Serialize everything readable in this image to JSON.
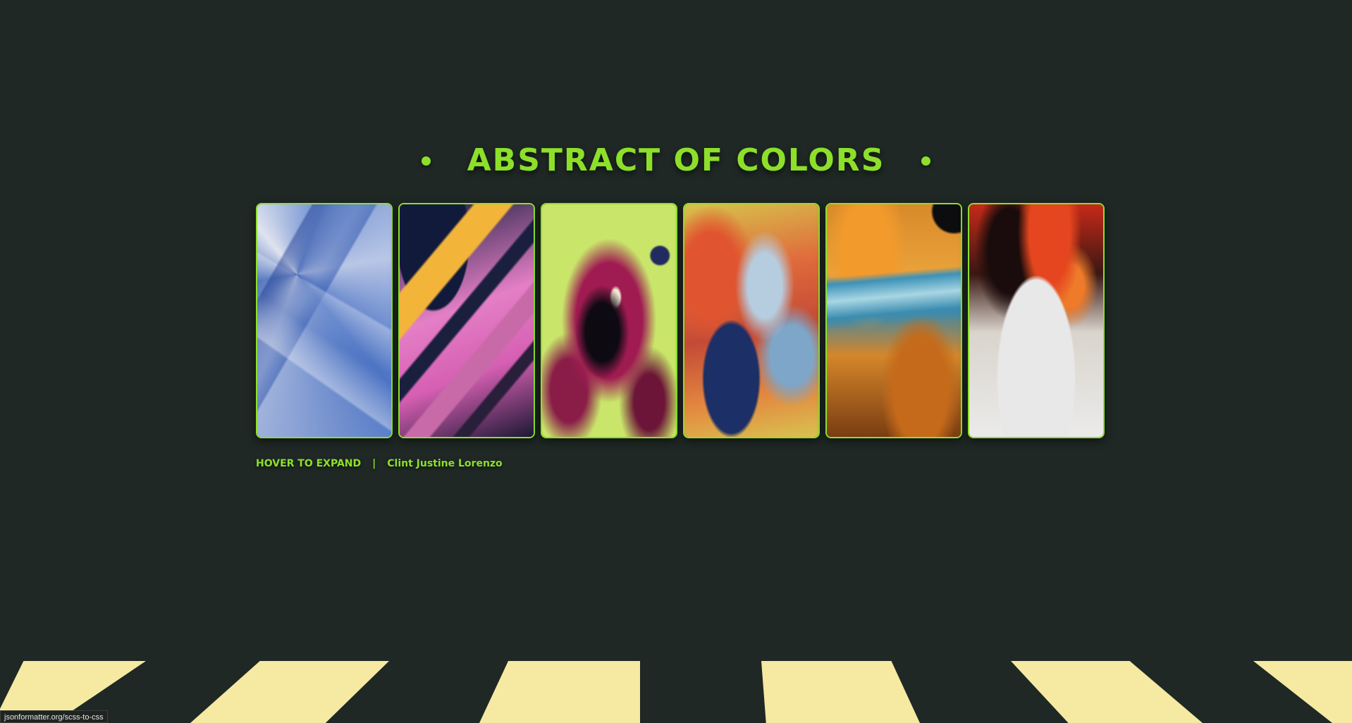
{
  "header": {
    "title": "ABSTRACT OF COLORS"
  },
  "gallery": {
    "cards": [
      {
        "name": "card-1"
      },
      {
        "name": "card-2"
      },
      {
        "name": "card-3"
      },
      {
        "name": "card-4"
      },
      {
        "name": "card-5"
      },
      {
        "name": "card-6"
      }
    ]
  },
  "footer": {
    "hint": "HOVER TO EXPAND",
    "separator": "|",
    "author": "Clint Justine Lorenzo"
  },
  "status_bar": {
    "url": "jsonformatter.org/scss-to-css"
  },
  "colors": {
    "background": "#1f2825",
    "accent": "#8de02a",
    "stripe": "#f6e9a2"
  }
}
